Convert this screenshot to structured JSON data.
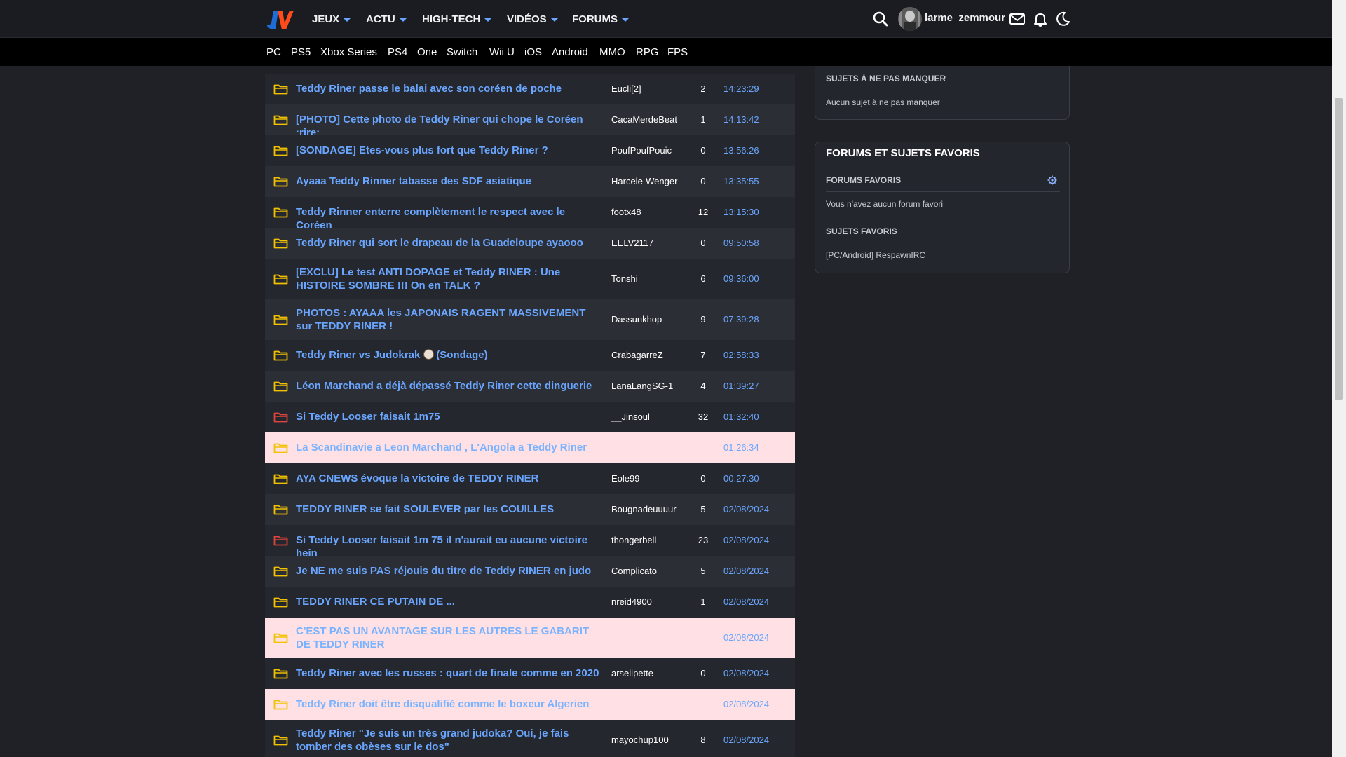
{
  "header": {
    "nav": [
      {
        "label": "JEUX"
      },
      {
        "label": "ACTU"
      },
      {
        "label": "HIGH-TECH"
      },
      {
        "label": "VIDÉOS"
      },
      {
        "label": "FORUMS"
      }
    ],
    "username": "larme_zemmour"
  },
  "subnav": [
    "PC",
    "PS5",
    "Xbox Series",
    "PS4",
    "One",
    "Switch",
    "Wii U",
    "iOS",
    "Android",
    "MMO",
    "RPG",
    "FPS"
  ],
  "colors": {
    "accent": "#6aa6ff",
    "folder_yellow": "#f2c200",
    "folder_red": "#e0453b",
    "flag_row": "#ffe0e4"
  },
  "topics": [
    {
      "title": "Teddy Riner passe le balai avec son coréen de poche",
      "author": "Eucli[2]",
      "count": "2",
      "time": "14:23:29",
      "icon": "folder-yellow",
      "flagged": false
    },
    {
      "title": "[PHOTO] Cette photo de Teddy Riner qui chope le Coréen :rire:",
      "author": "CacaMerdeBeat",
      "count": "1",
      "time": "14:13:42",
      "icon": "folder-yellow",
      "flagged": false
    },
    {
      "title": "[SONDAGE] Etes-vous plus fort que Teddy Riner ?",
      "author": "PoufPoufPouic",
      "count": "0",
      "time": "13:56:26",
      "icon": "folder-yellow",
      "flagged": false
    },
    {
      "title": "Ayaaa Teddy Rinner tabasse des SDF asiatique",
      "author": "Harcele-Wenger",
      "count": "0",
      "time": "13:35:55",
      "icon": "folder-yellow",
      "flagged": false
    },
    {
      "title": "Teddy Rinner enterre complètement le respect avec le Coréen",
      "author": "footx48",
      "count": "12",
      "time": "13:15:30",
      "icon": "folder-yellow",
      "flagged": false
    },
    {
      "title": "Teddy Riner qui sort le drapeau de la Guadeloupe ayaooo",
      "author": "EELV2117",
      "count": "0",
      "time": "09:50:58",
      "icon": "folder-yellow",
      "flagged": false
    },
    {
      "title": "[EXCLU] Le test ANTI DOPAGE et Teddy RINER : Une HISTOIRE SOMBRE !!! On en TALK ?",
      "author": "Tonshi",
      "count": "6",
      "time": "09:36:00",
      "icon": "folder-yellow",
      "flagged": false
    },
    {
      "title": "PHOTOS : AYAAA les JAPONAIS RAGENT MASSIVEMENT sur TEDDY RINER !",
      "author": "Dassunkhop",
      "count": "9",
      "time": "07:39:28",
      "icon": "folder-yellow",
      "flagged": false
    },
    {
      "title": "Teddy Riner vs Judokrak",
      "title_suffix": "(Sondage)",
      "author": "CrabagarreZ",
      "count": "7",
      "time": "02:58:33",
      "icon": "folder-yellow",
      "flagged": false,
      "emoji": true
    },
    {
      "title": "Léon Marchand a déjà dépassé Teddy Riner cette dinguerie",
      "author": "LanaLangSG-1",
      "count": "4",
      "time": "01:39:27",
      "icon": "folder-yellow",
      "flagged": false
    },
    {
      "title": "Si Teddy Looser faisait 1m75",
      "author": "__Jinsoul",
      "count": "32",
      "time": "01:32:40",
      "icon": "folder-red",
      "flagged": false
    },
    {
      "title": "La Scandinavie a Leon Marchand , L'Angola a Teddy Riner",
      "author": "",
      "count": "",
      "time": "01:26:34",
      "icon": "folder-yellow",
      "flagged": true
    },
    {
      "title": "AYA CNEWS évoque la victoire de TEDDY RINER",
      "author": "Eole99",
      "count": "0",
      "time": "00:27:30",
      "icon": "folder-yellow",
      "flagged": false
    },
    {
      "title": "TEDDY RINER se fait SOULEVER par les COUILLES",
      "author": "Bougnadeuuuur",
      "count": "5",
      "time": "02/08/2024",
      "icon": "folder-yellow",
      "flagged": false
    },
    {
      "title": "Si Teddy Looser faisait 1m 75 il n'aurait eu aucune victoire hein",
      "author": "thongerbell",
      "count": "23",
      "time": "02/08/2024",
      "icon": "folder-red",
      "flagged": false
    },
    {
      "title": "Je NE me suis PAS réjouis du titre de Teddy RINER en judo",
      "author": "Complicato",
      "count": "5",
      "time": "02/08/2024",
      "icon": "folder-yellow",
      "flagged": false
    },
    {
      "title": "TEDDY RINER CE PUTAIN DE ...",
      "author": "nreid4900",
      "count": "1",
      "time": "02/08/2024",
      "icon": "folder-yellow",
      "flagged": false
    },
    {
      "title": "C'EST PAS UN AVANTAGE SUR LES AUTRES LE GABARIT DE TEDDY RINER",
      "author": "",
      "count": "",
      "time": "02/08/2024",
      "icon": "folder-yellow",
      "flagged": true
    },
    {
      "title": "Teddy Riner avec les russes : quart de finale comme en 2020",
      "author": "arselipette",
      "count": "0",
      "time": "02/08/2024",
      "icon": "folder-yellow",
      "flagged": false
    },
    {
      "title": "Teddy Riner doit être disqualifié comme le boxeur Algerien",
      "author": "",
      "count": "",
      "time": "02/08/2024",
      "icon": "folder-yellow",
      "flagged": true
    },
    {
      "title": "Teddy Riner \"Je suis un très grand judoka? Oui, je fais tomber des obèses sur le dos\"",
      "author": "mayochup100",
      "count": "8",
      "time": "02/08/2024",
      "icon": "folder-yellow",
      "flagged": false
    }
  ],
  "sidebar": {
    "must_read_title": "SUJETS À NE PAS MANQUER",
    "must_read_empty": "Aucun sujet à ne pas manquer",
    "favorites_title": "FORUMS ET SUJETS FAVORIS",
    "favorite_forums_title": "FORUMS FAVORIS",
    "favorite_forums_empty": "Vous n'avez aucun forum favori",
    "favorite_topics_title": "SUJETS FAVORIS",
    "favorite_topics": [
      "[PC/Android] RespawnIRC"
    ]
  }
}
